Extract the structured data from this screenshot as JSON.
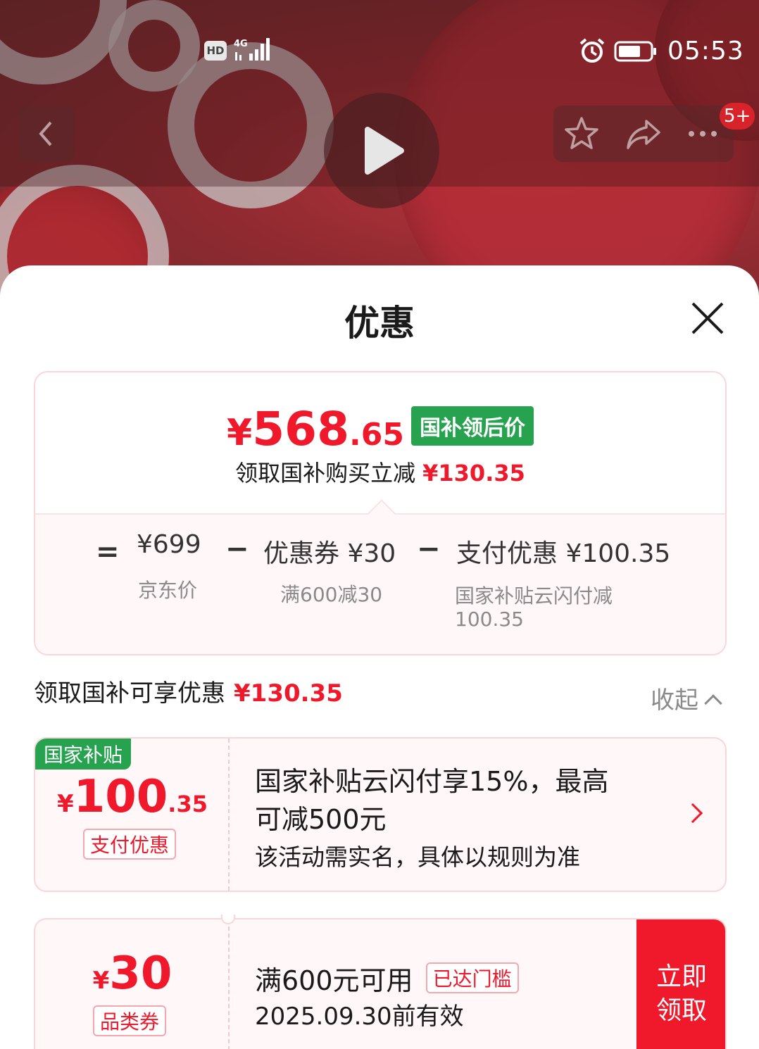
{
  "status_bar": {
    "hd": "HD",
    "network": "4G",
    "time": "05:53"
  },
  "nav": {
    "badge": "5+"
  },
  "sheet": {
    "title": "优惠"
  },
  "summary": {
    "price_yen": "¥",
    "price_int": "568",
    "price_dec": ".65",
    "price_tag": "国补领后价",
    "sub_label": "领取国补购买立减",
    "sub_amount": "¥130.35",
    "eq": "=",
    "minus": "−",
    "items": [
      {
        "value": "¥699",
        "label": "京东价"
      },
      {
        "value": "优惠券 ¥30",
        "label": "满600减30"
      },
      {
        "value": "支付优惠 ¥100.35",
        "label": "国家补贴云闪付减",
        "label2": "100.35"
      }
    ]
  },
  "section": {
    "title": "领取国补可享优惠",
    "amount": "¥130.35",
    "collapse_label": "收起"
  },
  "cards": [
    {
      "corner_tag": "国家补贴",
      "yen": "¥",
      "amount_int": "100",
      "amount_dec": ".35",
      "type_tag": "支付优惠",
      "title_line1": "国家补贴云闪付享15%，最高",
      "title_line2": "可减500元",
      "desc": "该活动需实名，具体以规则为准"
    },
    {
      "yen": "¥",
      "amount_int": "30",
      "type_tag": "品类券",
      "title": "满600元可用",
      "status_tag": "已达门槛",
      "validity": "2025.09.30前有效",
      "claim_line1": "立即",
      "claim_line2": "领取"
    }
  ],
  "colors": {
    "accent_red": "#f0192b",
    "green": "#27a350",
    "border_pink": "#f8d6da"
  },
  "icons": [
    "back-arrow-icon",
    "play-icon",
    "star-icon",
    "share-icon",
    "more-icon",
    "close-icon",
    "alarm-icon",
    "battery-icon",
    "signal-icon"
  ]
}
